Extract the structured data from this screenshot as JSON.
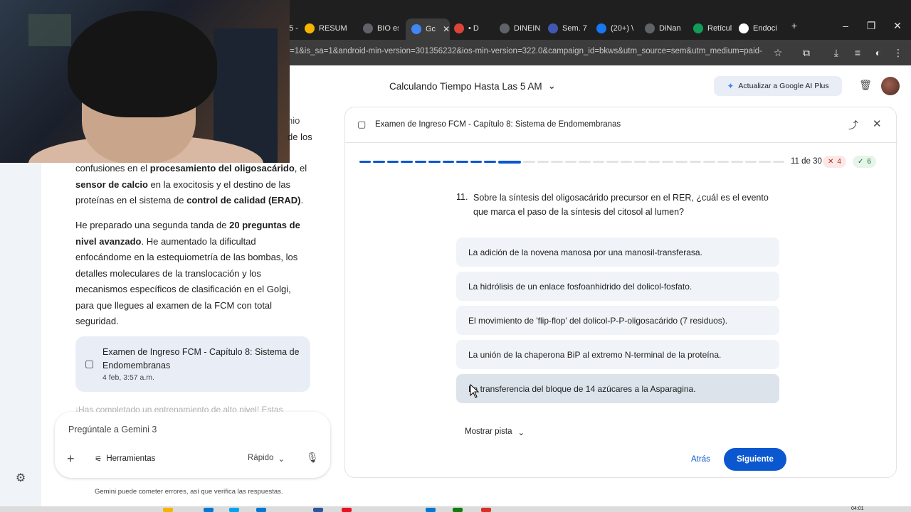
{
  "browser": {
    "tabs": [
      {
        "label": "25 -",
        "color": "#5f6368"
      },
      {
        "label": "RESUM",
        "color": "#f4b400"
      },
      {
        "label": "BIO es",
        "color": "#5f6368"
      },
      {
        "label": "Gc",
        "color": "#4285f4"
      },
      {
        "label": "• D",
        "color": "#db4437"
      },
      {
        "label": "DINEIN",
        "color": "#5f6368"
      },
      {
        "label": "Sem. 7",
        "color": "#4257b2"
      },
      {
        "label": "(20+) \\",
        "color": "#1877f2"
      },
      {
        "label": "DiNan",
        "color": "#5f6368"
      },
      {
        "label": "Retícul",
        "color": "#0f9d58"
      },
      {
        "label": "Endoci",
        "color": "#ffffff"
      }
    ],
    "url": "=1&is_sa=1&android-min-version=301356232&ios-min-version=322.0&campaign_id=bkws&utm_source=sem&utm_medium=paid-..."
  },
  "header": {
    "chat_title": "Calculando Tiempo Hasta Las 5 AM",
    "upgrade_label": "Actualizar a Google AI Plus"
  },
  "chat": {
    "partial_1": "nio",
    "partial_2": "de los",
    "para1": {
      "t1": "confusiones en el ",
      "b1": "procesamiento del oligosacárido",
      "t2": ", el ",
      "b2": "sensor de calcio",
      "t3": " en la exocitosis y el destino de las proteínas en el sistema de ",
      "b3": "control de calidad (ERAD)",
      "t4": "."
    },
    "para2": {
      "t1": "He preparado una segunda tanda de ",
      "b1": "20 preguntas de nivel avanzado",
      "t2": ". He aumentado la dificultad enfocándome en la estequiometría de las bombas, los detalles moleculares de la translocación y los mecanismos específicos de clasificación en el Golgi, para que llegues al examen de la FCM con total seguridad."
    },
    "artifact": {
      "title": "Examen de Ingreso FCM - Capítulo 8: Sistema de Endomembranas",
      "date": "4 feb, 3:57 a.m."
    },
    "faded_text": "¡Has completado un entrenamiento de alto nivel! Estas"
  },
  "input": {
    "placeholder": "Pregúntale a Gemini 3",
    "tools_label": "Herramientas",
    "model_label": "Rápido",
    "disclaimer": "Gemini puede cometer errores, así que verifica las respuestas."
  },
  "quiz": {
    "title": "Examen de Ingreso FCM - Capítulo 8: Sistema de Endomembranas",
    "progress": {
      "current": 11,
      "total": 30,
      "label": "11 de 30"
    },
    "wrong_count": "4",
    "right_count": "6",
    "question_number": "11.",
    "question": "Sobre la síntesis del oligosacárido precursor en el RER, ¿cuál es el evento que marca el paso de la síntesis del citosol al lumen?",
    "options": [
      "La adición de la novena manosa por una manosil-transferasa.",
      "La hidrólisis de un enlace fosfoanhidrido del dolicol-fosfato.",
      "El movimiento de 'flip-flop' del dolicol-P-P-oligosacárido (7 residuos).",
      "La unión de la chaperona BiP al extremo N-terminal de la proteína.",
      "La transferencia del bloque de 14 azúcares a la Asparagina."
    ],
    "hint_label": "Mostrar pista",
    "back_label": "Atrás",
    "next_label": "Siguiente"
  },
  "taskbar": {
    "clock": "04:01"
  }
}
